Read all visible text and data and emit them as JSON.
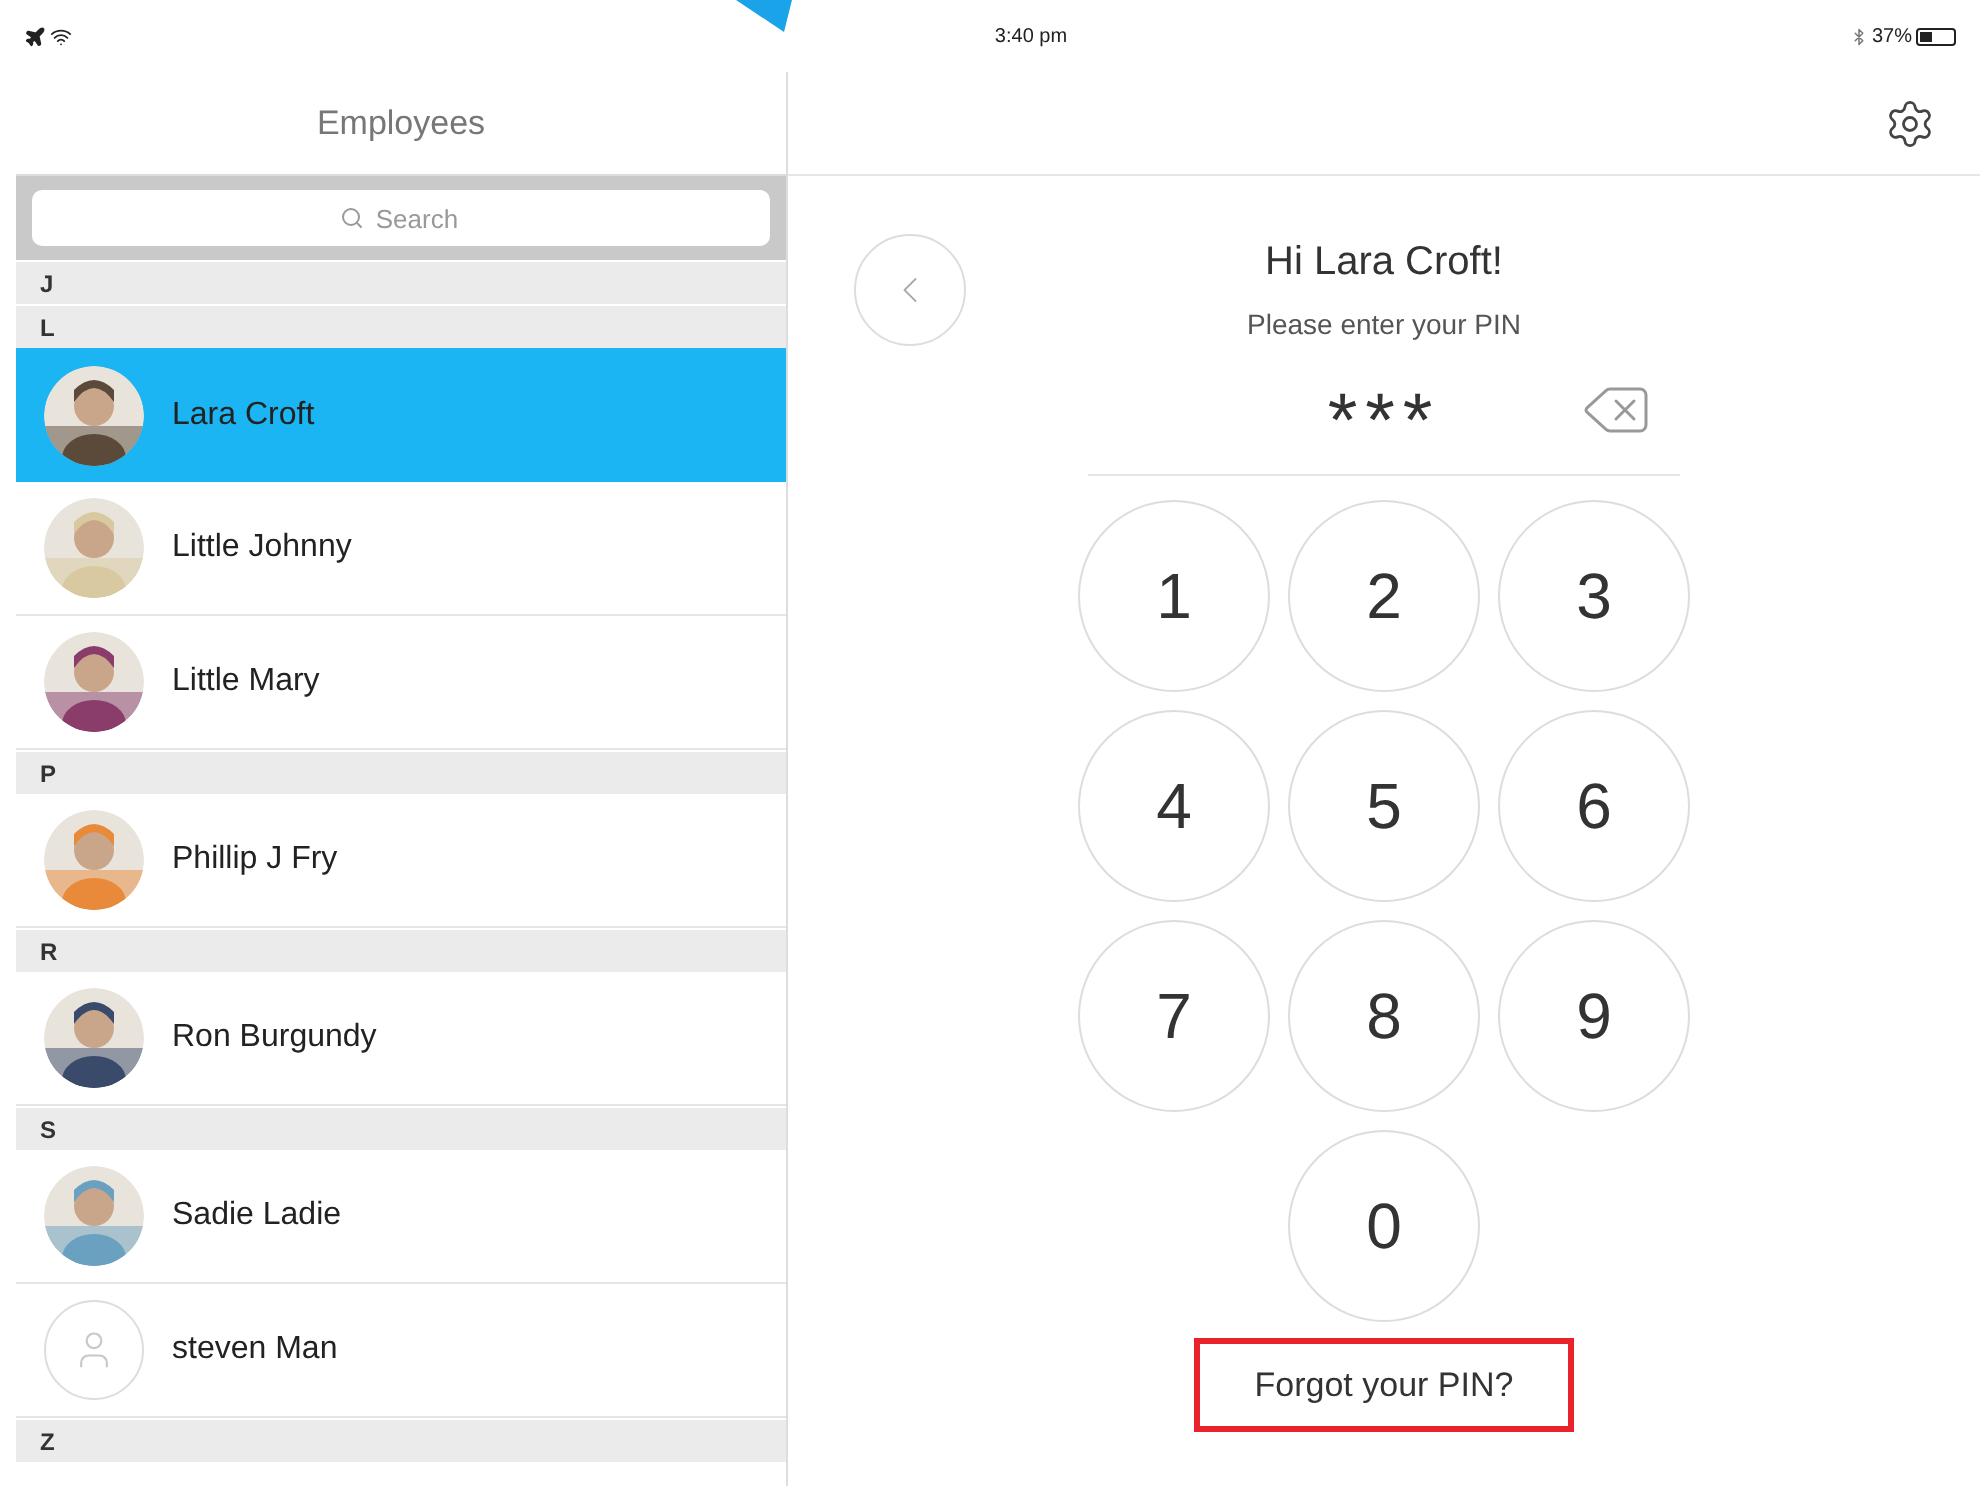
{
  "status_bar": {
    "time": "3:40 pm",
    "battery": "37%"
  },
  "sidebar": {
    "title": "Employees",
    "search": {
      "placeholder": "Search"
    },
    "sections": [
      {
        "letter": "J"
      },
      {
        "letter": "L",
        "employees": [
          {
            "name": "Lara Croft",
            "selected": true,
            "kind": "picture"
          },
          {
            "name": "Little Johnny",
            "selected": false,
            "kind": "picture"
          },
          {
            "name": "Little Mary",
            "selected": false,
            "kind": "picture"
          }
        ]
      },
      {
        "letter": "P",
        "employees": [
          {
            "name": "Phillip J Fry",
            "selected": false,
            "kind": "picture"
          }
        ]
      },
      {
        "letter": "R",
        "employees": [
          {
            "name": "Ron Burgundy",
            "selected": false,
            "kind": "picture"
          }
        ]
      },
      {
        "letter": "S",
        "employees": [
          {
            "name": "Sadie Ladie",
            "selected": false,
            "kind": "picture"
          },
          {
            "name": "steven Man",
            "selected": false,
            "kind": "placeholder"
          }
        ]
      },
      {
        "letter": "Z"
      }
    ]
  },
  "pin_panel": {
    "greeting": "Hi Lara Croft!",
    "prompt": "Please enter your PIN",
    "pin_display": "***",
    "keys": [
      "1",
      "2",
      "3",
      "4",
      "5",
      "6",
      "7",
      "8",
      "9",
      "0"
    ],
    "forgot_pin": {
      "label": "Forgot your PIN?",
      "highlighted": true
    }
  }
}
